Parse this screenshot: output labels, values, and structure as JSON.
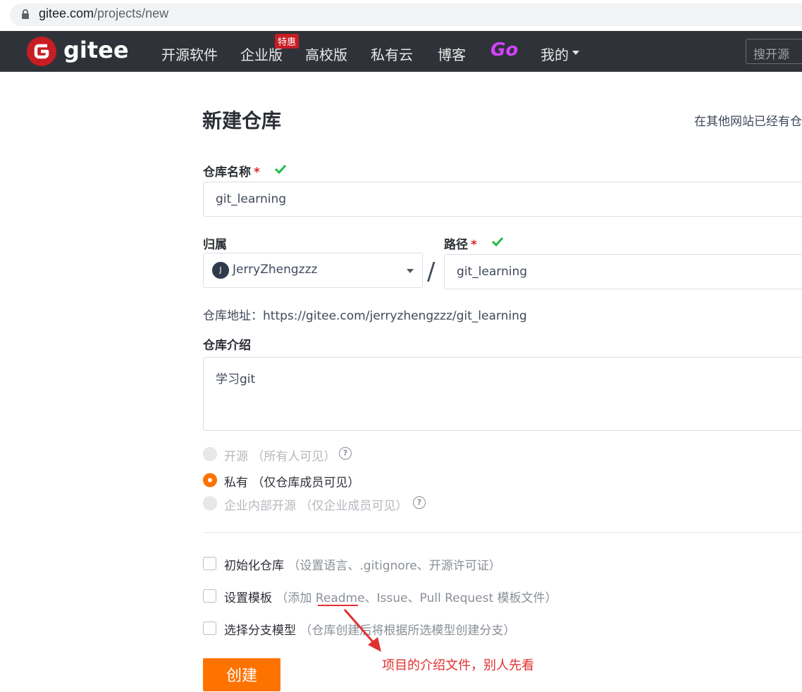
{
  "browser": {
    "url_domain": "gitee.com",
    "url_path": "/projects/new"
  },
  "nav": {
    "logo_text": "gitee",
    "items": [
      "开源软件",
      "企业版",
      "高校版",
      "私有云",
      "博客"
    ],
    "badge": "特惠",
    "go": "Go",
    "mine": "我的",
    "search_placeholder": "搜开源"
  },
  "page": {
    "title": "新建仓库",
    "import_hint": "在其他网站已经有仓",
    "repo_name_label": "仓库名称",
    "required_mark": "*",
    "repo_name_value": "git_learning",
    "owner_label": "归属",
    "owner_avatar": "J",
    "owner_value": "JerryZhengzzz",
    "slash": "/",
    "path_label": "路径",
    "path_value": "git_learning",
    "address": "仓库地址：https://gitee.com/jerryzhengzzz/git_learning",
    "intro_label": "仓库介绍",
    "intro_value": "学习git",
    "visibility": [
      {
        "label": "开源 （所有人可见）",
        "selected": false,
        "disabled": true,
        "help": true
      },
      {
        "label": "私有 （仅仓库成员可见）",
        "selected": true,
        "disabled": false,
        "help": false
      },
      {
        "label": "企业内部开源 （仅企业成员可见）",
        "selected": false,
        "disabled": true,
        "help": true
      }
    ],
    "options": [
      {
        "label": "初始化仓库",
        "hint": "（设置语言、.gitignore、开源许可证）"
      },
      {
        "label": "设置模板",
        "hint": "（添加 Readme、Issue、Pull Request 模板文件）"
      },
      {
        "label": "选择分支模型",
        "hint": "（仓库创建后将根据所选模型创建分支）"
      }
    ],
    "create_button": "创建",
    "annotation": "项目的介绍文件，别人先看"
  },
  "colors": {
    "nav_bg": "#2f3339",
    "brand_red": "#c71d23",
    "accent_orange": "#fe7300",
    "check_green": "#21ba45",
    "annotation_red": "#e03030"
  }
}
